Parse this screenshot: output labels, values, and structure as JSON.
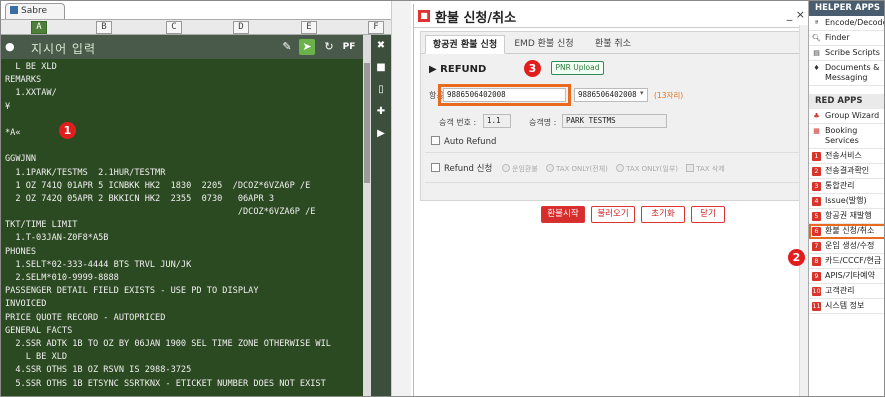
{
  "sabre": {
    "tab_label": "Sabre",
    "columns": [
      "A",
      "B",
      "C",
      "D",
      "E",
      "F"
    ],
    "command_placeholder": "지시어 입력",
    "tool_icons": [
      "edit-icon",
      "send-icon",
      "history-icon",
      "pf-icon"
    ],
    "toolbar_pf": "PF",
    "terminal_lines": [
      "  L BE XLD",
      "REMARKS",
      "  1.XXTAW/",
      "¥",
      "",
      "*A«",
      "",
      "GGWJNN",
      "  1.1PARK/TESTMS  2.1HUR/TESTMR",
      "  1 OZ 741Q 01APR 5 ICNBKK HK2  1830  2205  /DCOZ*6VZA6P /E",
      "  2 OZ 742Q 05APR 2 BKKICN HK2  2355  0730   06APR 3",
      "                                             /DCOZ*6VZA6P /E",
      "TKT/TIME LIMIT",
      "  1.T-03JAN-Z0F8*A5B",
      "PHONES",
      "  1.SELT*02-333-4444 BTS TRVL JUN/JK",
      "  2.SELM*010-9999-8888",
      "PASSENGER DETAIL FIELD EXISTS - USE PD TO DISPLAY",
      "INVOICED",
      "PRICE QUOTE RECORD - AUTOPRICED",
      "GENERAL FACTS",
      "  2.SSR ADTK 1B TO OZ BY 06JAN 1900 SEL TIME ZONE OTHERWISE WIL",
      "    L BE XLD",
      "  4.SSR OTHS 1B OZ RSVN IS 2988-3725",
      "  5.SSR OTHS 1B ETSYNC SSRTKNX - ETICKET NUMBER DOES NOT EXIST"
    ]
  },
  "dialog": {
    "title": "환불 신청/취소",
    "window_controls": "_ ×",
    "tabs": [
      "항공권 환불 신청",
      "EMD 환불 신청",
      "환불 취소"
    ],
    "section_title": "▶ REFUND",
    "pnr_upload": "PNR Upload",
    "ticket_label": "항공권 번호 :",
    "ticket_value": "9886506402008",
    "ticket_select": "9886506402008",
    "ticket_hint": "(13자리)",
    "pax_no_label": "승객 번호 :",
    "pax_no_value": "1.1",
    "pax_name_label": "승객명 :",
    "pax_name_value": "PARK TESTMS",
    "auto_refund": "Auto Refund",
    "refund_apply": "Refund 신청",
    "options": [
      "운임환불",
      "TAX ONLY(전체)",
      "TAX ONLY(일부)",
      "TAX 삭제"
    ],
    "buttons": {
      "start": "환불시작",
      "load": "불러오기",
      "reset": "초기화",
      "close": "닫기"
    }
  },
  "sidebar": {
    "helper_header": "HELPER APPS",
    "helper_items": [
      "Encode/Decode",
      "Finder",
      "Scribe Scripts",
      "Documents & Messaging"
    ],
    "red_header": "RED APPS",
    "red_items": [
      "Group Wizard",
      "Booking Services"
    ],
    "numbered": [
      {
        "num": "1",
        "label": "전송서비스"
      },
      {
        "num": "2",
        "label": "전송결과확인"
      },
      {
        "num": "3",
        "label": "통합관리"
      },
      {
        "num": "4",
        "label": "Issue(발행)"
      },
      {
        "num": "5",
        "label": "항공권 재발행"
      },
      {
        "num": "6",
        "label": "환불 신청/취소"
      },
      {
        "num": "7",
        "label": "운임 생성/수정"
      },
      {
        "num": "8",
        "label": "카드/CCCF/현금"
      },
      {
        "num": "9",
        "label": "APIS/기타예약"
      },
      {
        "num": "10",
        "label": "고객관리"
      },
      {
        "num": "11",
        "label": "시스템 정보"
      }
    ]
  },
  "callouts": [
    "1",
    "2",
    "3"
  ]
}
